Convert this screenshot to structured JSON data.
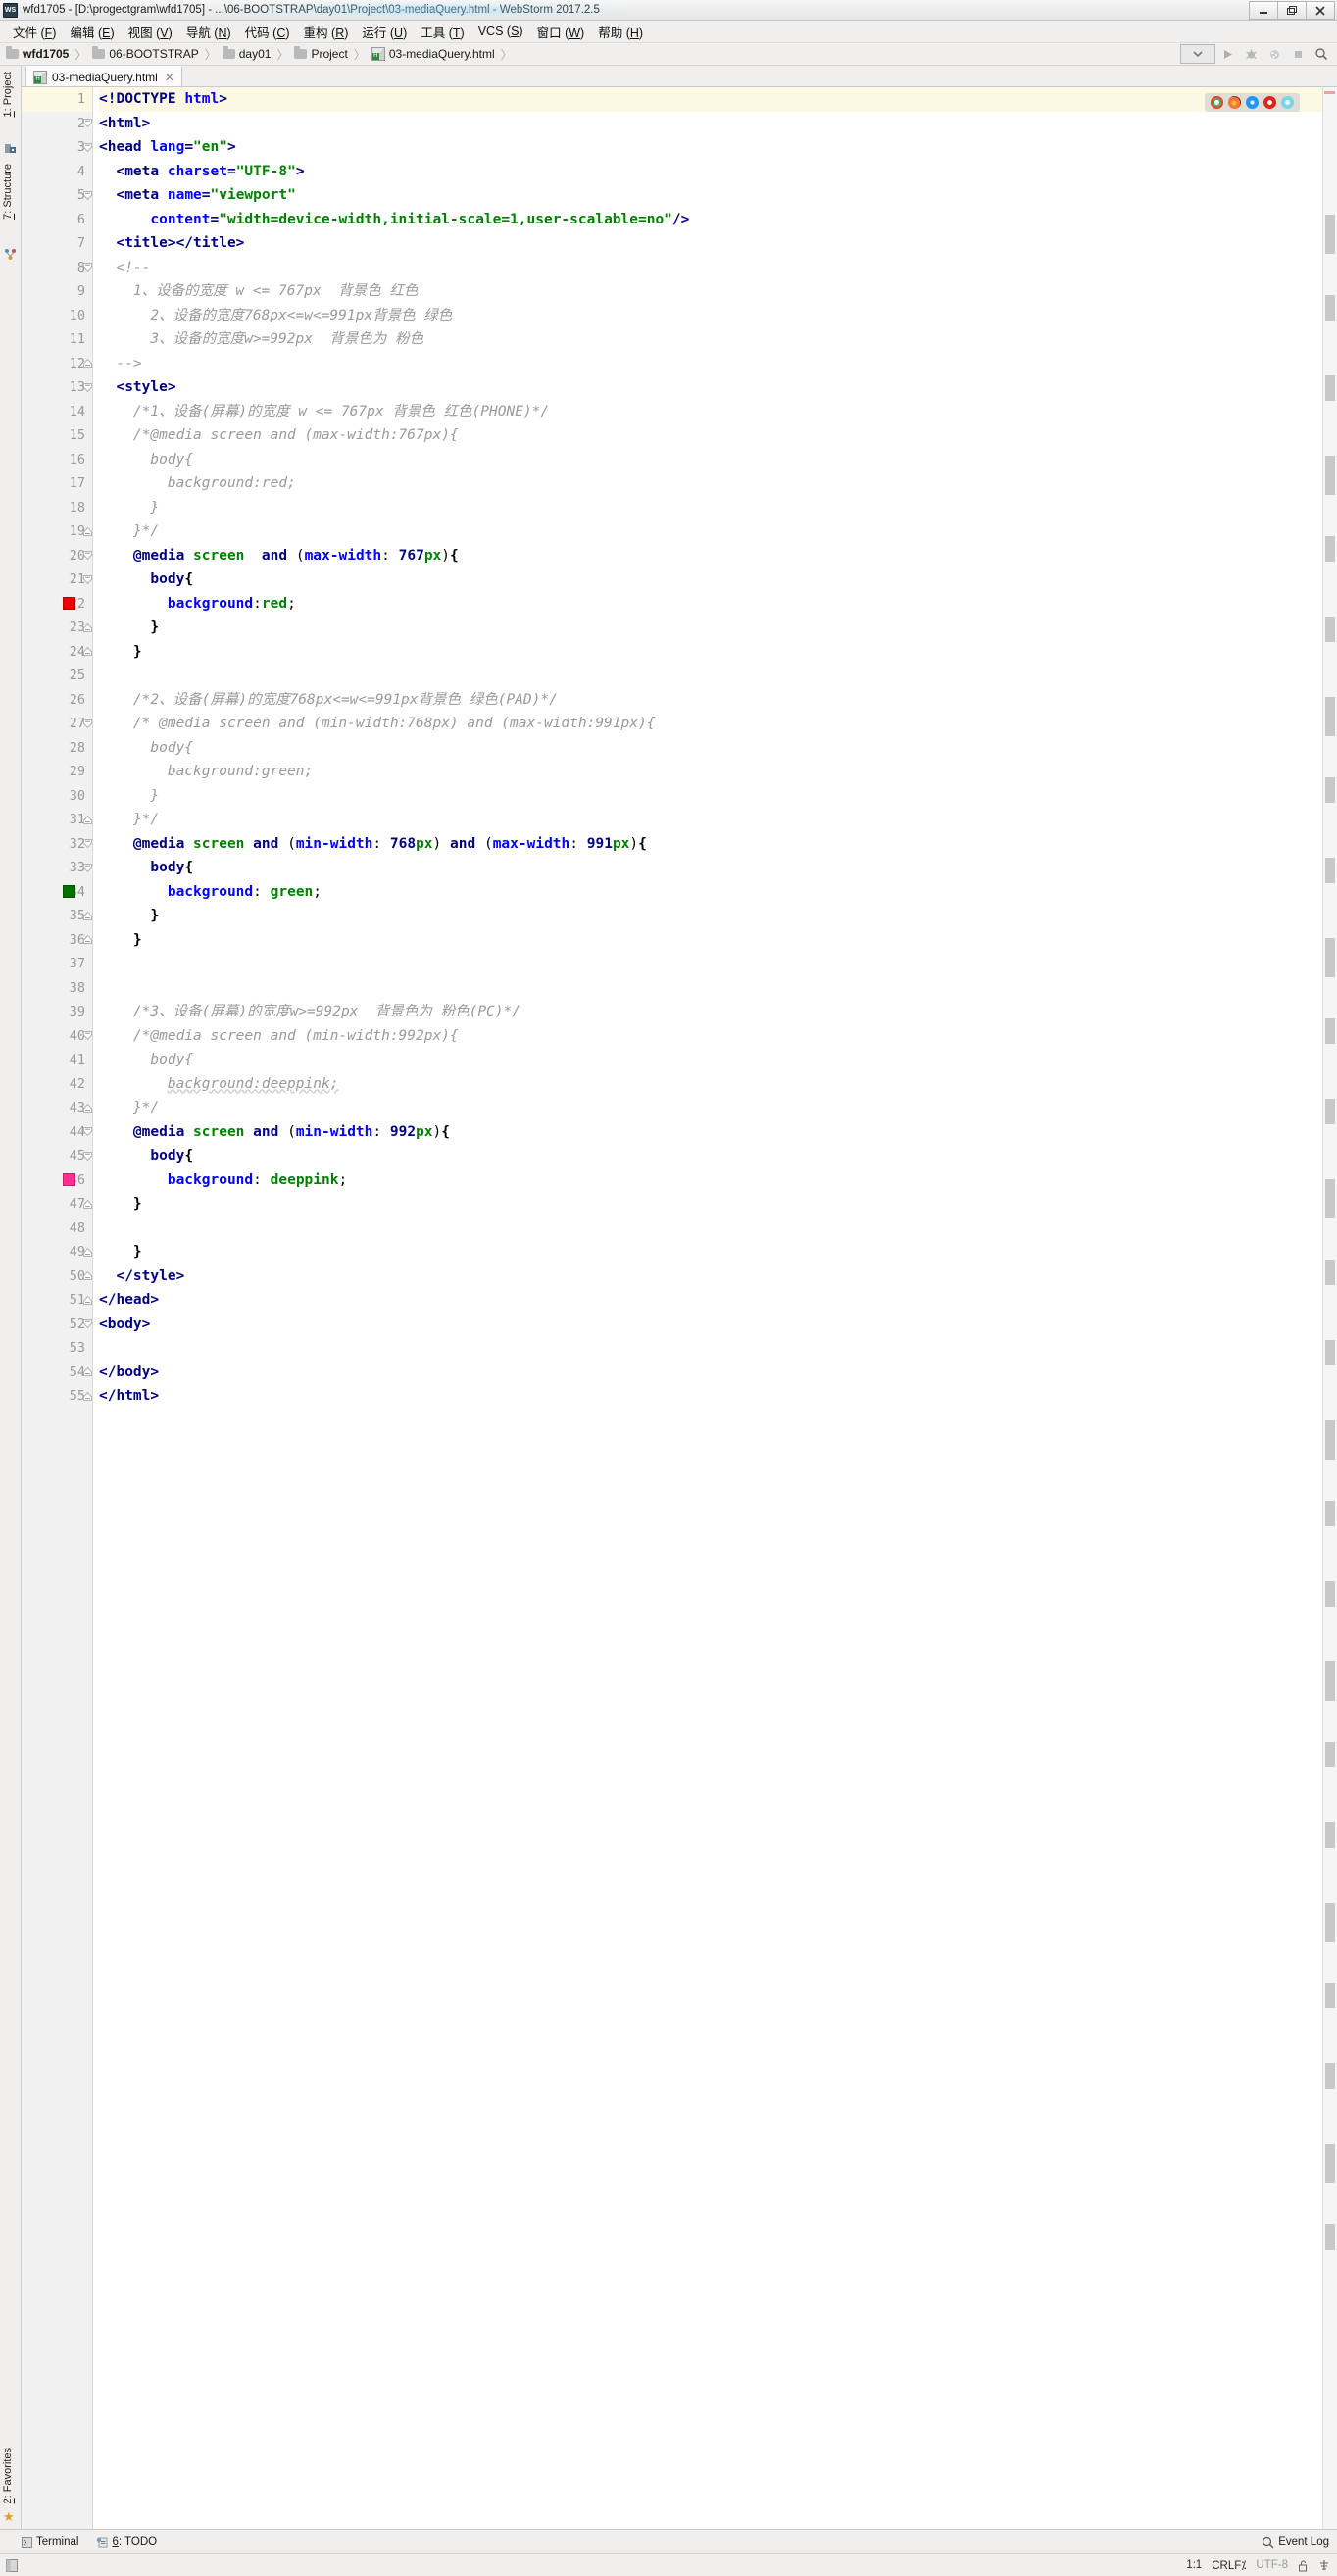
{
  "window": {
    "title": "wfd1705 - [D:\\progectgram\\wfd1705] - ...\\06-BOOTSTRAP\\day01\\Project\\03-mediaQuery.html - WebStorm 2017.2.5",
    "app_icon": "webstorm-icon",
    "controls": {
      "minimize": "minimize-icon",
      "maximize": "restore-icon",
      "close": "close-icon"
    }
  },
  "menubar": {
    "items": [
      {
        "label": "文件",
        "mnemonic": "F"
      },
      {
        "label": "编辑",
        "mnemonic": "E"
      },
      {
        "label": "视图",
        "mnemonic": "V"
      },
      {
        "label": "导航",
        "mnemonic": "N"
      },
      {
        "label": "代码",
        "mnemonic": "C"
      },
      {
        "label": "重构",
        "mnemonic": "R"
      },
      {
        "label": "运行",
        "mnemonic": "U"
      },
      {
        "label": "工具",
        "mnemonic": "T"
      },
      {
        "label": "VCS",
        "mnemonic": "S"
      },
      {
        "label": "窗口",
        "mnemonic": "W"
      },
      {
        "label": "帮助",
        "mnemonic": "H"
      }
    ]
  },
  "breadcrumb": {
    "items": [
      {
        "label": "wfd1705",
        "icon": "folder-icon"
      },
      {
        "label": "06-BOOTSTRAP",
        "icon": "folder-icon"
      },
      {
        "label": "day01",
        "icon": "folder-icon"
      },
      {
        "label": "Project",
        "icon": "folder-icon"
      },
      {
        "label": "03-mediaQuery.html",
        "icon": "html-file-icon"
      }
    ],
    "separator": "〉",
    "toolbar": [
      {
        "name": "run-configuration-selector",
        "icon": "chevron-down-icon"
      },
      {
        "name": "run-button",
        "icon": "play-icon"
      },
      {
        "name": "debug-button",
        "icon": "bug-icon"
      },
      {
        "name": "coverage-button",
        "icon": "coverage-icon"
      },
      {
        "name": "stop-button",
        "icon": "stop-icon"
      },
      {
        "name": "search-everywhere-button",
        "icon": "search-icon"
      }
    ]
  },
  "left_tool_strip": {
    "tabs": [
      {
        "label": "1: Project",
        "mnemonic": "1",
        "icon": "project-icon"
      },
      {
        "label": "7: Structure",
        "mnemonic": "7",
        "icon": "structure-icon"
      }
    ],
    "bottom": [
      {
        "label": "2: Favorites",
        "mnemonic": "2",
        "icon": "star-icon"
      }
    ]
  },
  "editor_tabs": [
    {
      "label": "03-mediaQuery.html",
      "icon": "html-file-icon",
      "active": true,
      "close": "close-icon"
    }
  ],
  "browser_preview": {
    "browsers": [
      "chrome-icon",
      "firefox-icon",
      "safari-icon",
      "opera-icon",
      "explorer-icon"
    ]
  },
  "editor": {
    "first_line": 1,
    "total_lines": 55,
    "highlighted_line": 1,
    "breakpoints": [
      {
        "line": 22,
        "color": "#ee0000"
      },
      {
        "line": 34,
        "color": "#007000"
      },
      {
        "line": 46,
        "color": "#ff2f92"
      }
    ],
    "lines": [
      {
        "n": 1,
        "indent": 0,
        "fold": "none",
        "tokens": [
          [
            "tag",
            "<!DOCTYPE "
          ],
          [
            "attr",
            "html"
          ],
          [
            "tag",
            ">"
          ]
        ]
      },
      {
        "n": 2,
        "indent": 0,
        "fold": "open",
        "tokens": [
          [
            "tag",
            "<html>"
          ]
        ]
      },
      {
        "n": 3,
        "indent": 0,
        "fold": "open",
        "tokens": [
          [
            "tag",
            "<head "
          ],
          [
            "attr",
            "lang"
          ],
          [
            "tag",
            "="
          ],
          [
            "str",
            "\"en\""
          ],
          [
            "tag",
            ">"
          ]
        ]
      },
      {
        "n": 4,
        "indent": 1,
        "fold": "none",
        "tokens": [
          [
            "tag",
            "<meta "
          ],
          [
            "attr",
            "charset"
          ],
          [
            "tag",
            "="
          ],
          [
            "str",
            "\"UTF-8\""
          ],
          [
            "tag",
            ">"
          ]
        ]
      },
      {
        "n": 5,
        "indent": 1,
        "fold": "open",
        "tokens": [
          [
            "tag",
            "<meta "
          ],
          [
            "attr",
            "name"
          ],
          [
            "tag",
            "="
          ],
          [
            "str",
            "\"viewport\""
          ]
        ]
      },
      {
        "n": 6,
        "indent": 3,
        "fold": "none",
        "tokens": [
          [
            "attr",
            "content"
          ],
          [
            "tag",
            "="
          ],
          [
            "str",
            "\"width=device-width,initial-scale=1,user-scalable=no\""
          ],
          [
            "tag",
            "/>"
          ]
        ]
      },
      {
        "n": 7,
        "indent": 1,
        "fold": "none",
        "tokens": [
          [
            "tag",
            "<title></title>"
          ]
        ]
      },
      {
        "n": 8,
        "indent": 1,
        "fold": "open",
        "tokens": [
          [
            "cmt",
            "<!--"
          ]
        ]
      },
      {
        "n": 9,
        "indent": 2,
        "fold": "none",
        "tokens": [
          [
            "cmt",
            "1、设备的宽度 w <= 767px  背景色 红色"
          ]
        ]
      },
      {
        "n": 10,
        "indent": 3,
        "fold": "none",
        "tokens": [
          [
            "cmt",
            "2、设备的宽度768px<=w<=991px背景色 绿色"
          ]
        ]
      },
      {
        "n": 11,
        "indent": 3,
        "fold": "none",
        "tokens": [
          [
            "cmt",
            "3、设备的宽度w>=992px  背景色为 粉色"
          ]
        ]
      },
      {
        "n": 12,
        "indent": 1,
        "fold": "close",
        "tokens": [
          [
            "cmt",
            "-->"
          ]
        ]
      },
      {
        "n": 13,
        "indent": 1,
        "fold": "open",
        "tokens": [
          [
            "tag",
            "<style>"
          ]
        ]
      },
      {
        "n": 14,
        "indent": 2,
        "fold": "none",
        "tokens": [
          [
            "cmt",
            "/*1、设备(屏幕)的宽度 w <= 767px 背景色 红色(PHONE)*/"
          ]
        ]
      },
      {
        "n": 15,
        "indent": 2,
        "fold": "none",
        "tokens": [
          [
            "cmt",
            "/*@media screen and (max-width:767px){"
          ]
        ]
      },
      {
        "n": 16,
        "indent": 3,
        "fold": "none",
        "tokens": [
          [
            "cmt",
            "body{"
          ]
        ]
      },
      {
        "n": 17,
        "indent": 4,
        "fold": "none",
        "tokens": [
          [
            "cmt",
            "background:red;"
          ]
        ]
      },
      {
        "n": 18,
        "indent": 3,
        "fold": "none",
        "tokens": [
          [
            "cmt",
            "}"
          ]
        ]
      },
      {
        "n": 19,
        "indent": 2,
        "fold": "close",
        "tokens": [
          [
            "cmt",
            "}*/"
          ]
        ]
      },
      {
        "n": 20,
        "indent": 2,
        "fold": "open",
        "tokens": [
          [
            "at",
            "@media "
          ],
          [
            "media",
            "screen"
          ],
          [
            "plain",
            "  "
          ],
          [
            "at",
            "and"
          ],
          [
            "plain",
            " ("
          ],
          [
            "prop",
            "max-width"
          ],
          [
            "plain",
            ": "
          ],
          [
            "num",
            "767"
          ],
          [
            "unit",
            "px"
          ],
          [
            "plain",
            ")"
          ],
          [
            "punc",
            "{"
          ]
        ]
      },
      {
        "n": 21,
        "indent": 3,
        "fold": "open",
        "tokens": [
          [
            "sel",
            "body"
          ],
          [
            "punc",
            "{"
          ]
        ]
      },
      {
        "n": 22,
        "indent": 4,
        "fold": "none",
        "tokens": [
          [
            "prop",
            "background"
          ],
          [
            "plain",
            ":"
          ],
          [
            "val",
            "red"
          ],
          [
            "plain",
            ";"
          ]
        ]
      },
      {
        "n": 23,
        "indent": 3,
        "fold": "close",
        "tokens": [
          [
            "punc",
            "}"
          ]
        ]
      },
      {
        "n": 24,
        "indent": 2,
        "fold": "close",
        "tokens": [
          [
            "punc",
            "}"
          ]
        ]
      },
      {
        "n": 25,
        "indent": 0,
        "fold": "none",
        "tokens": []
      },
      {
        "n": 26,
        "indent": 2,
        "fold": "none",
        "tokens": [
          [
            "cmt",
            "/*2、设备(屏幕)的宽度768px<=w<=991px背景色 绿色(PAD)*/"
          ]
        ]
      },
      {
        "n": 27,
        "indent": 2,
        "fold": "open",
        "tokens": [
          [
            "cmt",
            "/* @media screen and (min-width:768px) and (max-width:991px){"
          ]
        ]
      },
      {
        "n": 28,
        "indent": 3,
        "fold": "none",
        "tokens": [
          [
            "cmt",
            "body{"
          ]
        ]
      },
      {
        "n": 29,
        "indent": 4,
        "fold": "none",
        "tokens": [
          [
            "cmt",
            "background:green;"
          ]
        ]
      },
      {
        "n": 30,
        "indent": 3,
        "fold": "none",
        "tokens": [
          [
            "cmt",
            "}"
          ]
        ]
      },
      {
        "n": 31,
        "indent": 2,
        "fold": "close",
        "tokens": [
          [
            "cmt",
            "}*/"
          ]
        ]
      },
      {
        "n": 32,
        "indent": 2,
        "fold": "open",
        "tokens": [
          [
            "at",
            "@media "
          ],
          [
            "media",
            "screen"
          ],
          [
            "plain",
            " "
          ],
          [
            "at",
            "and"
          ],
          [
            "plain",
            " ("
          ],
          [
            "prop",
            "min-width"
          ],
          [
            "plain",
            ": "
          ],
          [
            "num",
            "768"
          ],
          [
            "unit",
            "px"
          ],
          [
            "plain",
            ") "
          ],
          [
            "at",
            "and"
          ],
          [
            "plain",
            " ("
          ],
          [
            "prop",
            "max-width"
          ],
          [
            "plain",
            ": "
          ],
          [
            "num",
            "991"
          ],
          [
            "unit",
            "px"
          ],
          [
            "plain",
            ")"
          ],
          [
            "punc",
            "{"
          ]
        ]
      },
      {
        "n": 33,
        "indent": 3,
        "fold": "open",
        "tokens": [
          [
            "sel",
            "body"
          ],
          [
            "punc",
            "{"
          ]
        ]
      },
      {
        "n": 34,
        "indent": 4,
        "fold": "none",
        "tokens": [
          [
            "prop",
            "background"
          ],
          [
            "plain",
            ": "
          ],
          [
            "val",
            "green"
          ],
          [
            "plain",
            ";"
          ]
        ]
      },
      {
        "n": 35,
        "indent": 3,
        "fold": "close",
        "tokens": [
          [
            "punc",
            "}"
          ]
        ]
      },
      {
        "n": 36,
        "indent": 2,
        "fold": "close",
        "tokens": [
          [
            "punc",
            "}"
          ]
        ]
      },
      {
        "n": 37,
        "indent": 0,
        "fold": "none",
        "tokens": []
      },
      {
        "n": 38,
        "indent": 0,
        "fold": "none",
        "tokens": []
      },
      {
        "n": 39,
        "indent": 2,
        "fold": "none",
        "tokens": [
          [
            "cmt",
            "/*3、设备(屏幕)的宽度w>=992px  背景色为 粉色(PC)*/"
          ]
        ]
      },
      {
        "n": 40,
        "indent": 2,
        "fold": "open",
        "tokens": [
          [
            "cmt",
            "/*@media screen and (min-width:992px){"
          ]
        ]
      },
      {
        "n": 41,
        "indent": 3,
        "fold": "none",
        "tokens": [
          [
            "cmt",
            "body{"
          ]
        ]
      },
      {
        "n": 42,
        "indent": 4,
        "fold": "none",
        "tokens": [
          [
            "cmtu",
            "background:deeppink;"
          ]
        ]
      },
      {
        "n": 43,
        "indent": 2,
        "fold": "close",
        "tokens": [
          [
            "cmt",
            "}*/"
          ]
        ]
      },
      {
        "n": 44,
        "indent": 2,
        "fold": "open",
        "tokens": [
          [
            "at",
            "@media "
          ],
          [
            "media",
            "screen"
          ],
          [
            "plain",
            " "
          ],
          [
            "at",
            "and"
          ],
          [
            "plain",
            " ("
          ],
          [
            "prop",
            "min-width"
          ],
          [
            "plain",
            ": "
          ],
          [
            "num",
            "992"
          ],
          [
            "unit",
            "px"
          ],
          [
            "plain",
            ")"
          ],
          [
            "punc",
            "{"
          ]
        ]
      },
      {
        "n": 45,
        "indent": 3,
        "fold": "open",
        "tokens": [
          [
            "sel",
            "body"
          ],
          [
            "punc",
            "{"
          ]
        ]
      },
      {
        "n": 46,
        "indent": 4,
        "fold": "none",
        "tokens": [
          [
            "prop",
            "background"
          ],
          [
            "plain",
            ": "
          ],
          [
            "val",
            "deeppink"
          ],
          [
            "plain",
            ";"
          ]
        ]
      },
      {
        "n": 47,
        "indent": 2,
        "fold": "close",
        "tokens": [
          [
            "punc",
            "}"
          ]
        ]
      },
      {
        "n": 48,
        "indent": 0,
        "fold": "none",
        "tokens": []
      },
      {
        "n": 49,
        "indent": 2,
        "fold": "close",
        "tokens": [
          [
            "punc",
            "}"
          ]
        ]
      },
      {
        "n": 50,
        "indent": 1,
        "fold": "close",
        "tokens": [
          [
            "tag",
            "</style>"
          ]
        ]
      },
      {
        "n": 51,
        "indent": 0,
        "fold": "close",
        "tokens": [
          [
            "tag",
            "</head>"
          ]
        ]
      },
      {
        "n": 52,
        "indent": 0,
        "fold": "open",
        "tokens": [
          [
            "tag",
            "<body>"
          ]
        ]
      },
      {
        "n": 53,
        "indent": 0,
        "fold": "none",
        "tokens": []
      },
      {
        "n": 54,
        "indent": 0,
        "fold": "close",
        "tokens": [
          [
            "tag",
            "</body>"
          ]
        ]
      },
      {
        "n": 55,
        "indent": 0,
        "fold": "close",
        "tokens": [
          [
            "tag",
            "</html>"
          ]
        ]
      }
    ]
  },
  "bottom_tool_window": {
    "items": [
      {
        "label": "Terminal",
        "icon": "terminal-icon"
      },
      {
        "label": "6: TODO",
        "mnemonic": "6",
        "icon": "todo-icon"
      }
    ],
    "right": {
      "label": "Event Log",
      "icon": "event-log-icon"
    }
  },
  "statusbar": {
    "left_icon": "tool-window-toggle-icon",
    "caret_position": "1:1",
    "line_separator": "CRLF",
    "encoding": "UTF-8",
    "lock": "unlocked-icon",
    "inspection": "inspection-icon"
  },
  "colors": {
    "tag": "#000080",
    "attribute": "#0000ff",
    "string": "#008000",
    "comment": "#9a9a9a",
    "highlight_line": "#fdf8e3",
    "breakpoint_red": "#ee0000",
    "breakpoint_green": "#007000",
    "breakpoint_pink": "#ff2f92"
  }
}
